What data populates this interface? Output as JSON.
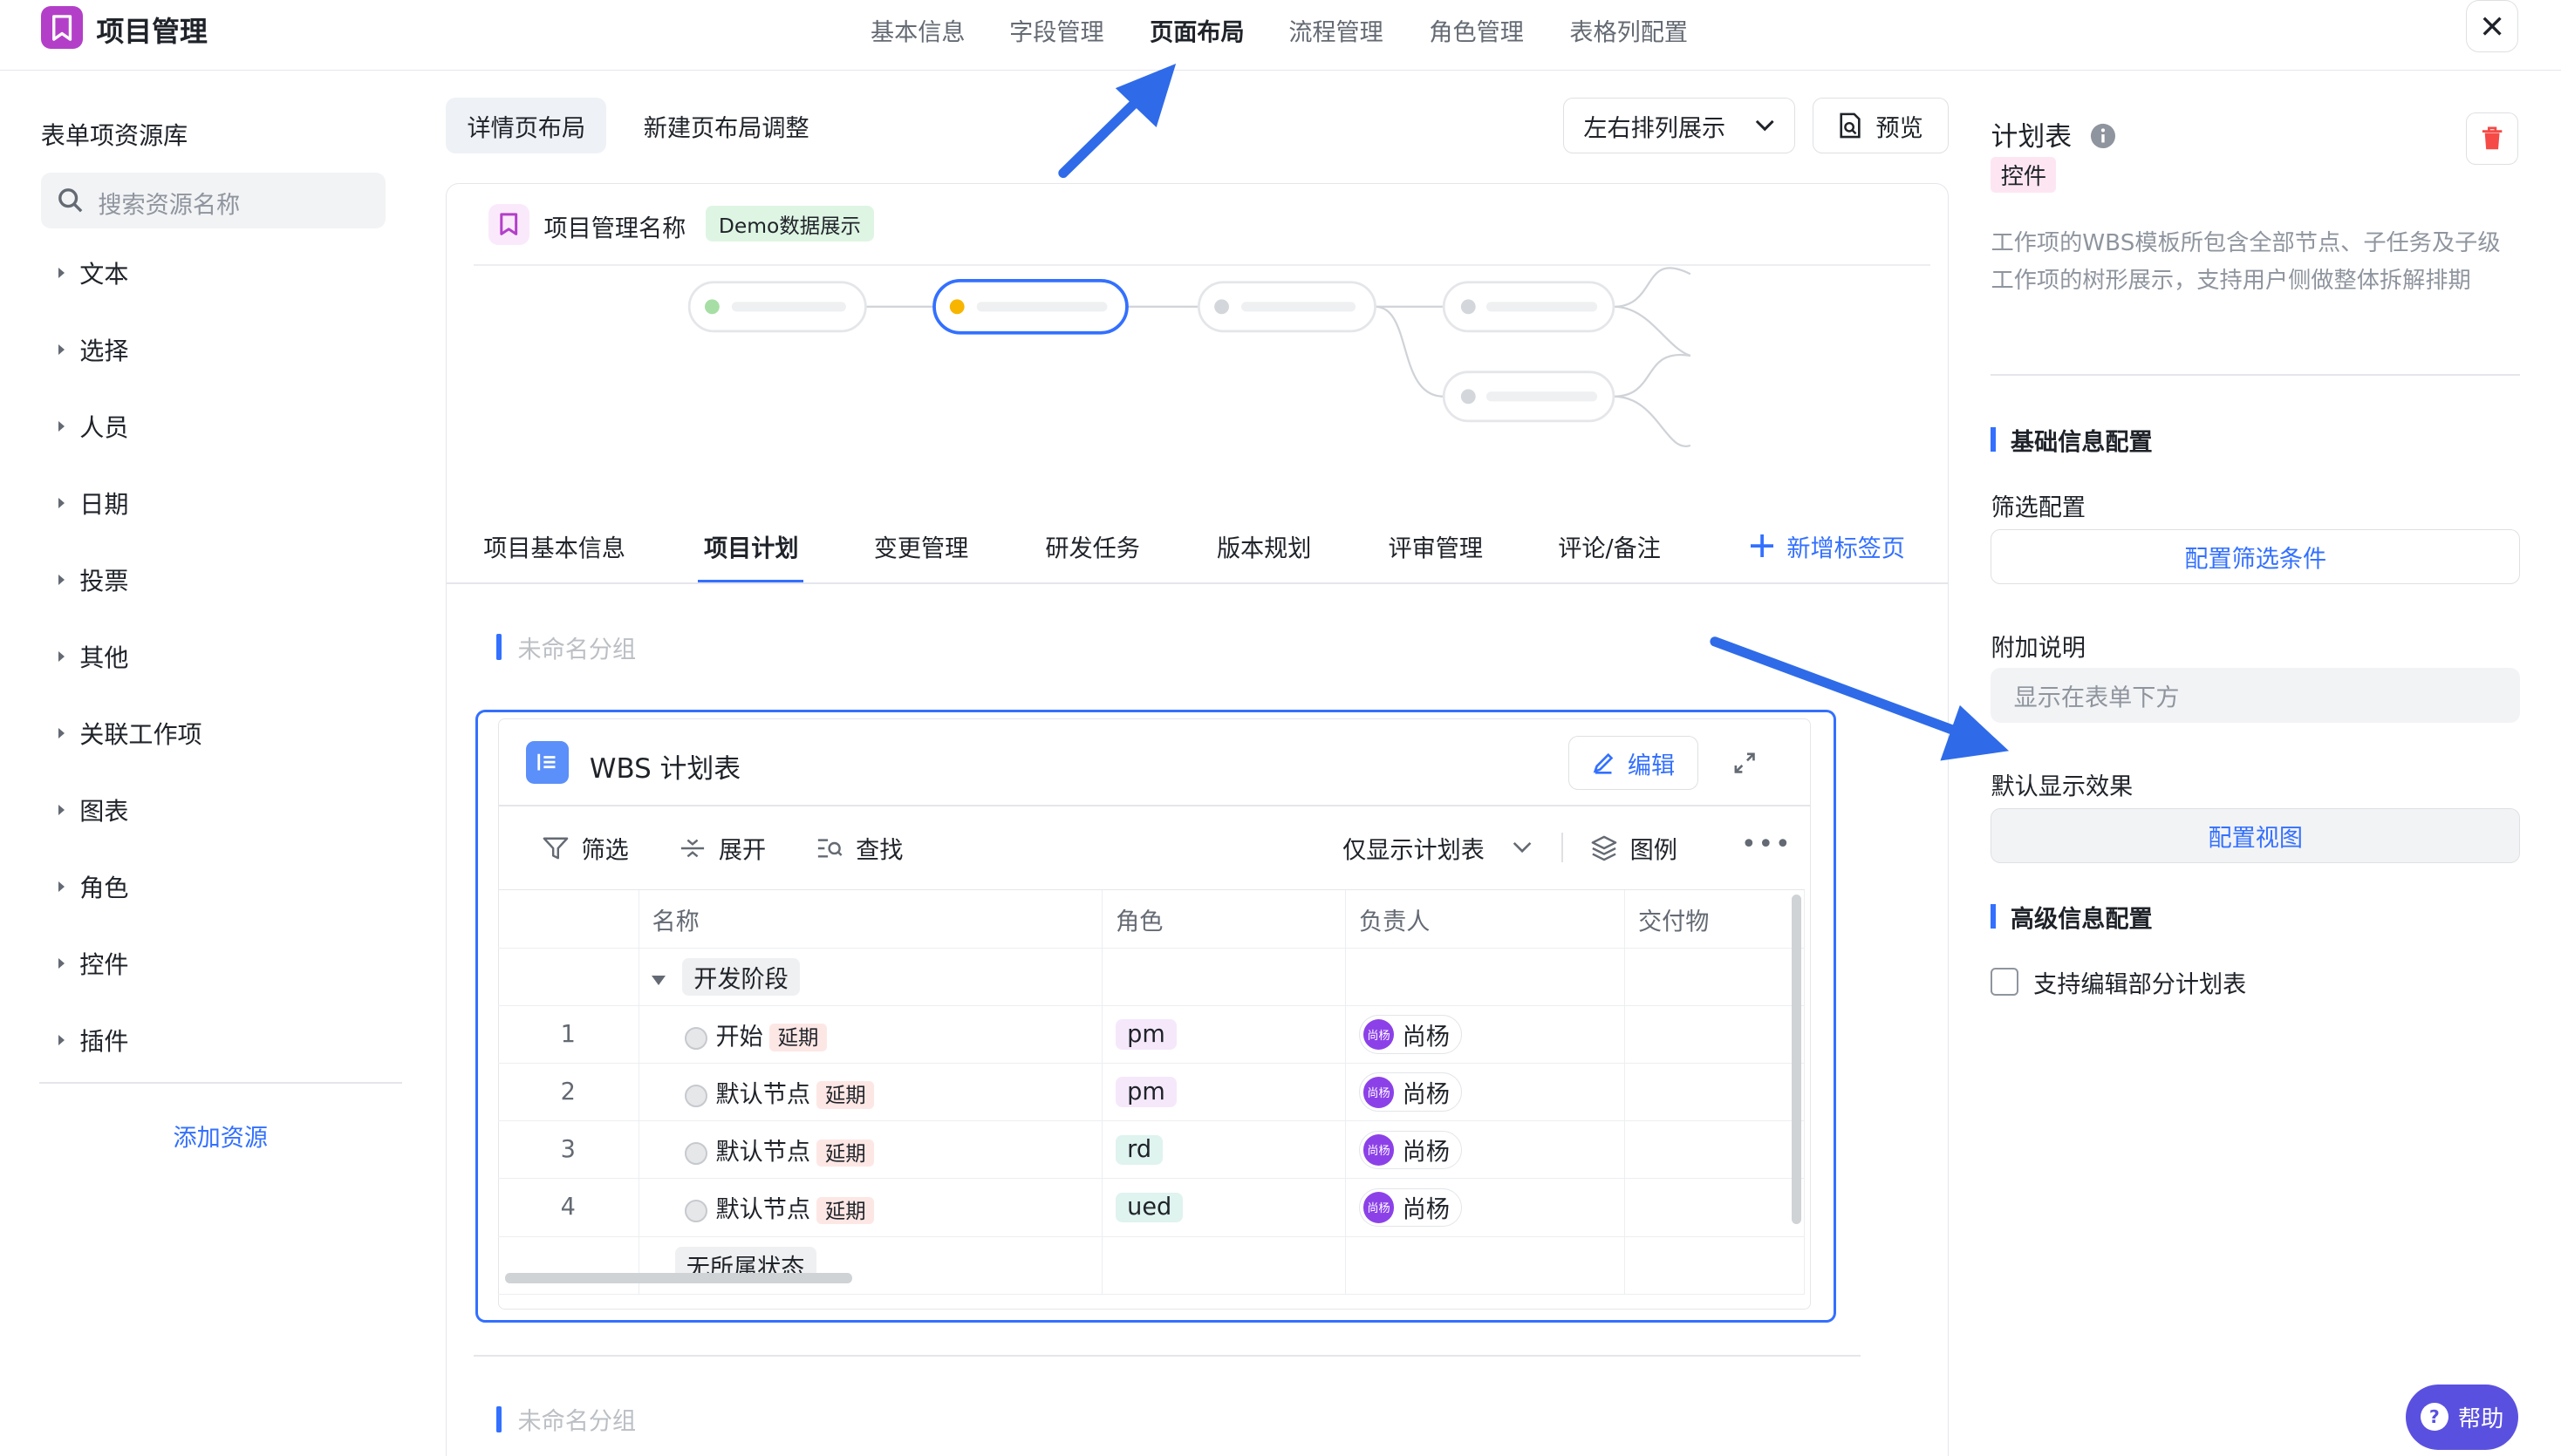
{
  "header": {
    "app_title": "项目管理",
    "nav": [
      "基本信息",
      "字段管理",
      "页面布局",
      "流程管理",
      "角色管理",
      "表格列配置"
    ],
    "active_nav": "页面布局",
    "icons": {
      "logo": "bookmark-icon",
      "close": "close-icon"
    }
  },
  "sidebar": {
    "title": "表单项资源库",
    "search_placeholder": "搜索资源名称",
    "categories": [
      "文本",
      "选择",
      "人员",
      "日期",
      "投票",
      "其他",
      "关联工作项",
      "图表",
      "角色",
      "控件",
      "插件"
    ],
    "add_resource": "添加资源"
  },
  "toolbar": {
    "tabs": [
      "详情页布局",
      "新建页布局调整"
    ],
    "layout_select": "左右排列展示",
    "preview": "预览"
  },
  "canvas": {
    "project_name": "项目管理名称",
    "demo_tag": "Demo数据展示",
    "page_tabs": [
      "项目基本信息",
      "项目计划",
      "变更管理",
      "研发任务",
      "版本规划",
      "评审管理",
      "评论/备注"
    ],
    "active_tab": "项目计划",
    "add_tab": "新增标签页",
    "group_label": "未命名分组",
    "group_label_2": "未命名分组"
  },
  "wbs": {
    "title": "WBS 计划表",
    "edit": "编辑",
    "tools": {
      "filter": "筛选",
      "expand": "展开",
      "find": "查找",
      "view_select": "仅显示计划表",
      "legend": "图例"
    },
    "columns": [
      "名称",
      "角色",
      "负责人",
      "交付物"
    ],
    "stage": "开发阶段",
    "rows": [
      {
        "num": "1",
        "name": "开始",
        "tag": "延期",
        "role": "pm",
        "owner": "尚杨",
        "avatar": "尚杨"
      },
      {
        "num": "2",
        "name": "默认节点",
        "tag": "延期",
        "role": "pm",
        "owner": "尚杨",
        "avatar": "尚杨"
      },
      {
        "num": "3",
        "name": "默认节点",
        "tag": "延期",
        "role": "rd",
        "owner": "尚杨",
        "avatar": "尚杨"
      },
      {
        "num": "4",
        "name": "默认节点",
        "tag": "延期",
        "role": "ued",
        "owner": "尚杨",
        "avatar": "尚杨"
      }
    ],
    "no_status": "无所属状态",
    "role_colors": {
      "pm": "#f5e8fb",
      "rd": "#dff3ef",
      "ued": "#dff3ef"
    }
  },
  "right_panel": {
    "title": "计划表",
    "tag": "控件",
    "description": "工作项的WBS模板所包含全部节点、子任务及子级工作项的树形展示，支持用户侧做整体拆解排期",
    "basic_section": "基础信息配置",
    "filter_label": "筛选配置",
    "filter_button": "配置筛选条件",
    "note_label": "附加说明",
    "note_placeholder": "显示在表单下方",
    "default_label": "默认显示效果",
    "default_button": "配置视图",
    "advanced_section": "高级信息配置",
    "checkbox_label": "支持编辑部分计划表"
  },
  "help": "帮助",
  "colors": {
    "accent": "#3370ff",
    "brand": "#b33fc9",
    "arrow": "#2f6be8"
  }
}
